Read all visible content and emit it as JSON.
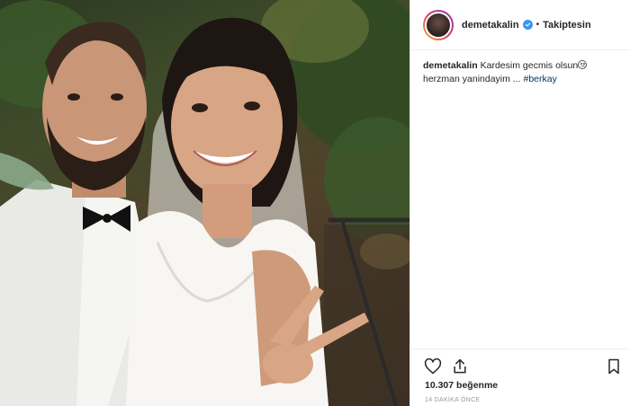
{
  "post": {
    "photo_alt": "",
    "header": {
      "username": "demetakalin",
      "separator": "•",
      "follow_label": "Takiptesin"
    },
    "caption": {
      "username": "demetakalin",
      "text_line1": "Kardesim gecmis olsun",
      "text_line2": "herzman yanindayim ...",
      "hashtag": "#berkay"
    },
    "actions": {
      "like_icon": "heart-icon",
      "share_icon": "share-icon",
      "save_icon": "bookmark-icon"
    },
    "likes_label": "10.307 beğenme",
    "timestamp": "14 DAKİKA ÖNCE"
  },
  "colors": {
    "verified_badge": "#3897f0",
    "hashtag": "#003569",
    "border": "#efefef",
    "text": "#262626",
    "muted": "#999999"
  }
}
